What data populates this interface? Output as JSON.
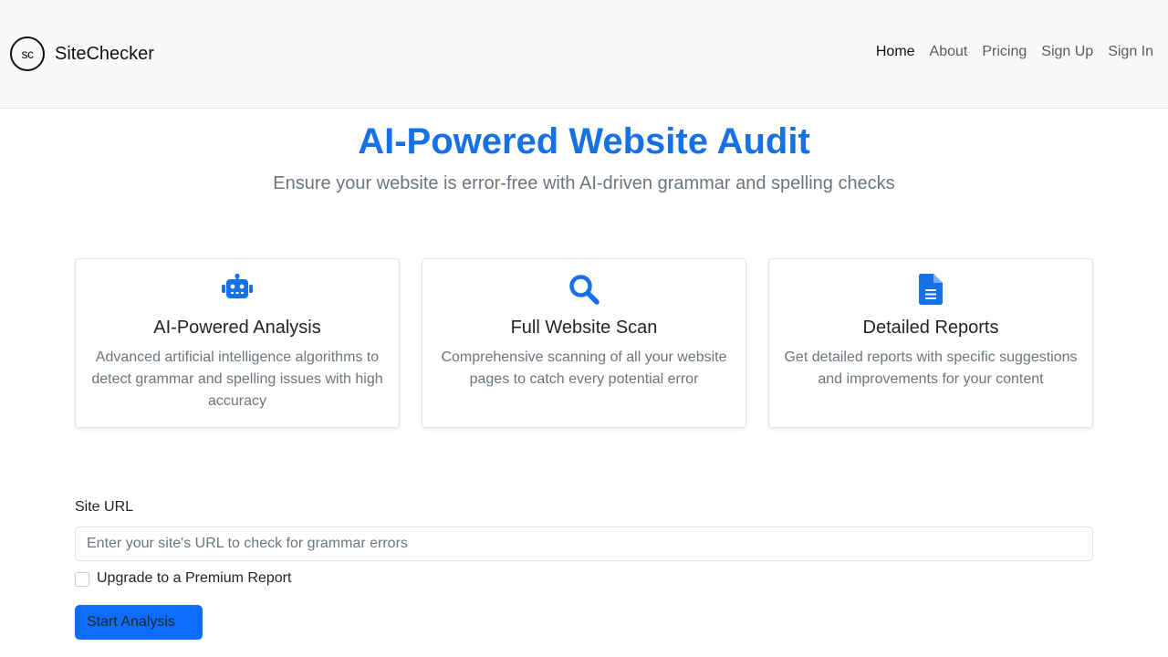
{
  "header": {
    "logo_text": "sc",
    "brand": "SiteChecker",
    "nav": [
      {
        "label": "Home",
        "active": true
      },
      {
        "label": "About",
        "active": false
      },
      {
        "label": "Pricing",
        "active": false
      },
      {
        "label": "Sign Up",
        "active": false
      },
      {
        "label": "Sign In",
        "active": false
      }
    ]
  },
  "hero": {
    "title": "AI-Powered Website Audit",
    "subtitle": "Ensure your website is error-free with AI-driven grammar and spelling checks"
  },
  "features": [
    {
      "icon": "robot-icon",
      "title": "AI-Powered Analysis",
      "description": "Advanced artificial intelligence algorithms to detect grammar and spelling issues with high accuracy"
    },
    {
      "icon": "search-icon",
      "title": "Full Website Scan",
      "description": "Comprehensive scanning of all your website pages to catch every potential error"
    },
    {
      "icon": "document-icon",
      "title": "Detailed Reports",
      "description": "Get detailed reports with specific suggestions and improvements for your content"
    }
  ],
  "form": {
    "url_label": "Site URL",
    "url_placeholder": "Enter your site's URL to check for grammar errors",
    "url_value": "",
    "premium_label": "Upgrade to a Premium Report",
    "premium_checked": false,
    "submit_label": "Start Analysis"
  },
  "colors": {
    "accent": "#1670e6",
    "button": "#0d6efd",
    "navbar_bg": "#f8f9fa",
    "muted_text": "#6c757d"
  }
}
